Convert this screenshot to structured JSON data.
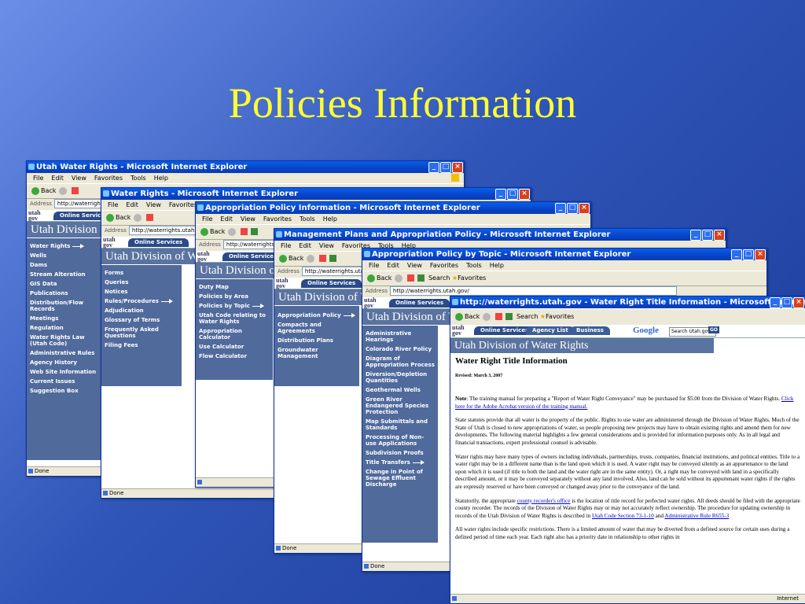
{
  "slide": {
    "title": "Policies Information"
  },
  "menus": {
    "file": "File",
    "edit": "Edit",
    "view": "View",
    "favorites": "Favorites",
    "tools": "Tools",
    "help": "Help"
  },
  "toolbar": {
    "back": "Back",
    "search": "Search",
    "favorites": "Favorites"
  },
  "addr_label": "Address",
  "status_done": "Done",
  "utah": {
    "online_services": "Online Services",
    "agency_list": "Agency List",
    "business": "Business",
    "division": "Utah Division of Water Rights"
  },
  "win1": {
    "title": "Utah Water Rights - Microsoft Internet Explorer",
    "url": "http://waterrights.utah.gov/",
    "nav": [
      "Water Rights",
      "Wells",
      "Dams",
      "Stream Alteration",
      "GIS Data",
      "Publications",
      "Distribution/Flow Records",
      "Meetings",
      "Regulation",
      "Water Rights Law (Utah Code)",
      "Administrative Rules",
      "Agency History",
      "Web Site Information",
      "Current Issues",
      "Suggestion Box"
    ]
  },
  "win2": {
    "title": "Water Rights - Microsoft Internet Explorer",
    "url": "http://waterrights.utah.gov/",
    "nav": [
      "Forms",
      "Queries",
      "Notices",
      "Rules/Procedures",
      "Adjudication",
      "Glossary of Terms",
      "Frequently Asked Questions",
      "Filing Fees"
    ]
  },
  "win3": {
    "title": "Appropriation Policy Information - Microsoft Internet Explorer",
    "url": "http://waterrights.utah.gov/",
    "nav": [
      "Duty Map",
      "Policies by Area",
      "Policies by Topic",
      "Utah Code relating to Water Rights",
      "Appropriation Calculator",
      "Use Calculator",
      "Flow Calculator"
    ]
  },
  "win4": {
    "title": "Management Plans and Appropriation Policy - Microsoft Internet Explorer",
    "url": "http://waterrights.utah.gov/",
    "nav": [
      "Appropriation Policy",
      "Compacts and Agreements",
      "Distribution Plans",
      "Groundwater Management"
    ]
  },
  "win5": {
    "title": "Appropriation Policy by Topic - Microsoft Internet Explorer",
    "url": "http://waterrights.utah.gov/",
    "nav": [
      "Administrative Hearings",
      "Colorado River Policy",
      "Diagram of Appropriation Process",
      "Diversion/Depletion Quantities",
      "Geothermal Wells",
      "Green River Endangered Species Protection",
      "Map Submittals and Standards",
      "Processing of Non-use Applications",
      "Subdivision Proofs",
      "Title Transfers",
      "Change in Point of Sewage Effluent Discharge"
    ]
  },
  "win6": {
    "title": "http://waterrights.utah.gov - Water Right Title Information - Microsoft Internet Explorer",
    "google": "Google",
    "search_placeholder": "Search Utah.gov",
    "go": "GO",
    "heading": "Water Right Title Information",
    "revised": "Revised: March 3, 2007",
    "p1_lead": "Note",
    "p1": ": The training manual for preparing a \"Report of Water Right Conveyance\" may be purchased for $5.00 from the Division of Water Rights.",
    "p1_link": "Click here for the Adobe Acrobat version of the training manual.",
    "p2": "State statutes provide that all water is the property of the public. Rights to use water are administered through the Division of Water Rights. Much of the State of Utah is closed to new appropriations of water, so people proposing new projects may have to obtain existing rights and amend them for new developments. The following material highlights a few general considerations and is provided for information purposes only. As in all legal and financial transactions, expert professional counsel is advisable.",
    "p3": "Water rights may have many types of owners including individuals, partnerships, trusts, companies, financial institutions, and political entities. Title to a water right may be in a different name than is the land upon which it is used. A water right may be conveyed silently as an appurtenance to the land upon which it is used (if title to both the land and the water right are in the same entity). Or, a right may be conveyed with land in a specifically described amount, or it may be conveyed separately without any land involved. Also, land can be sold without its appurtenant water rights if the rights are expressly reserved or have been conveyed or changed away prior to the conveyance of the land.",
    "p4a": "Statutorily, the appropriate",
    "p4_link1": "county recorder's office",
    "p4b": "is the location of title record for perfected water rights. All deeds should be filed with the appropriate county recorder. The records of the Division of Water Rights may or may not accurately reflect ownership. The procedure for updating ownership in records of the Utah Division of Water Rights is described in",
    "p4_link2": "Utah Code Section 73-1-10",
    "p4c": "and",
    "p4_link3": "Administrative Rule R655-3",
    "p5": "All water rights include specific restrictions. There is a limited amount of water that may be diverted from a defined source for certain uses during a defined period of time each year. Each right also has a priority date in relationship to other rights in",
    "status_zone": "Internet"
  }
}
